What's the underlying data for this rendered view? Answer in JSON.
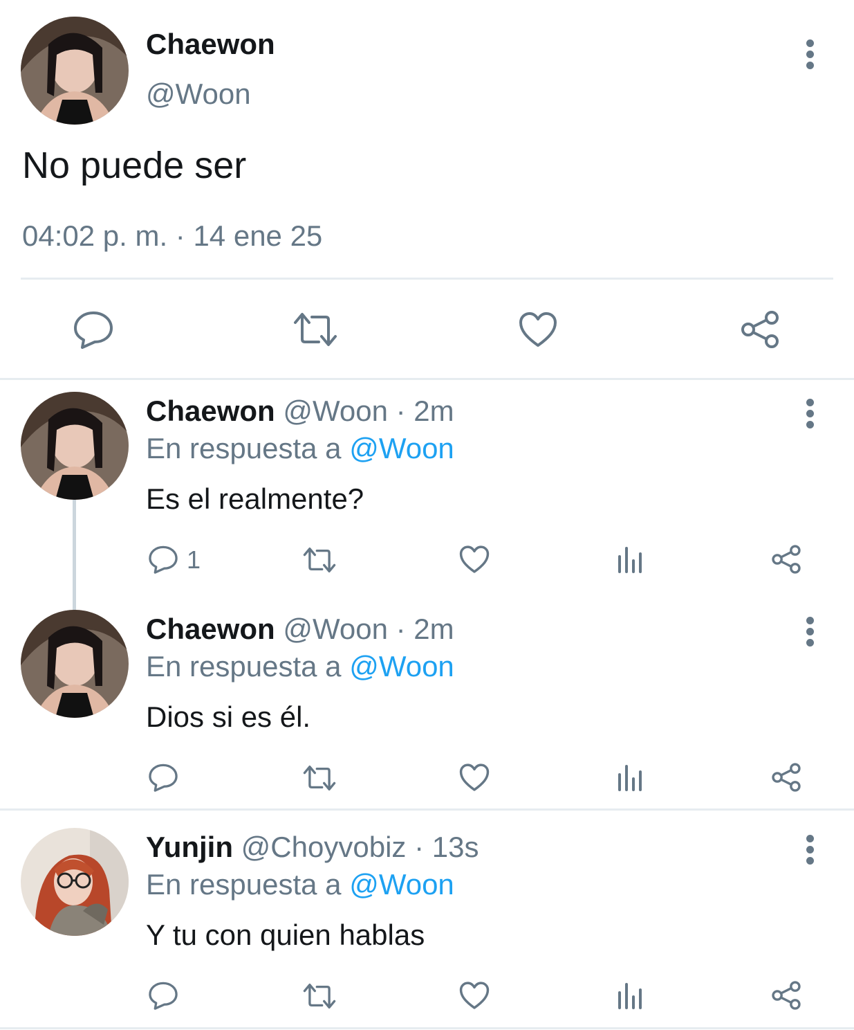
{
  "main_tweet": {
    "name": "Chaewon",
    "handle": "@Woon",
    "text": "No puede ser",
    "timestamp": "04:02 p. m. · 14 ene 25"
  },
  "replies": [
    {
      "name": "Chaewon",
      "handle": "@Woon",
      "time": "2m",
      "in_reply_label": "En respuesta a",
      "mention": "@Woon",
      "text": "Es el realmente?",
      "reply_count": "1"
    },
    {
      "name": "Chaewon",
      "handle": "@Woon",
      "time": "2m",
      "in_reply_label": "En respuesta a",
      "mention": "@Woon",
      "text": "Dios si es él."
    },
    {
      "name": "Yunjin",
      "handle": "@Choyvobiz",
      "time": "13s",
      "in_reply_label": "En respuesta a",
      "mention": "@Woon",
      "text": "Y tu con quien hablas"
    }
  ],
  "separator": " · ",
  "icons": [
    "reply-icon",
    "retweet-icon",
    "like-icon",
    "analytics-icon",
    "share-icon",
    "more-icon"
  ],
  "colors": {
    "text": "#14171a",
    "muted": "#657786",
    "link": "#1da1f2",
    "divider": "#e6ecf0"
  }
}
